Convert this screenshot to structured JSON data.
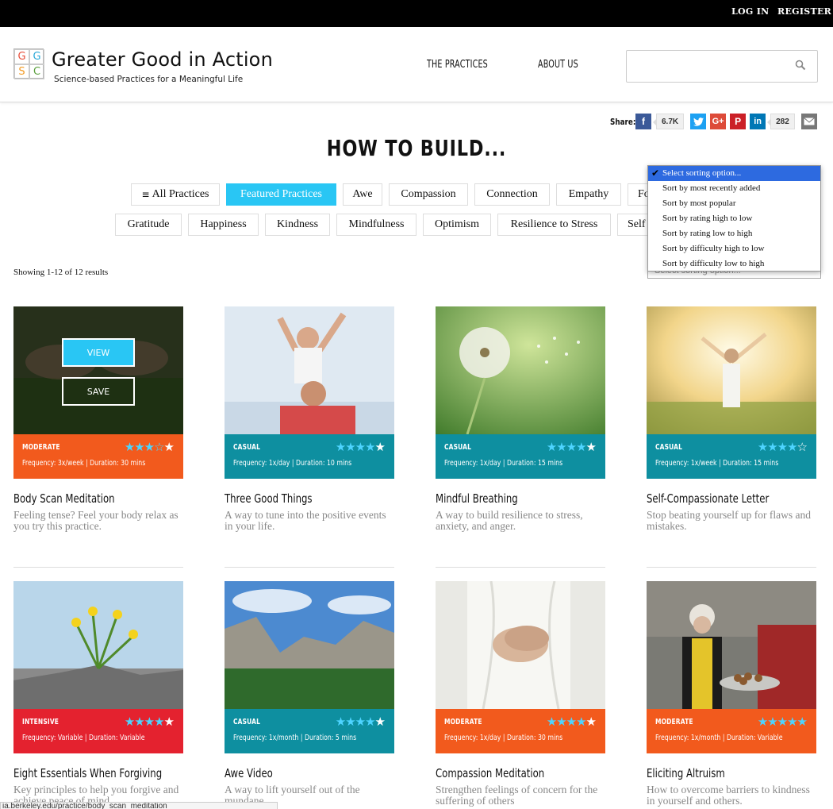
{
  "topbar": {
    "login": "LOG IN",
    "register": "REGISTER"
  },
  "logo": {
    "letters": [
      "G",
      "G",
      "S",
      "C"
    ],
    "title": "Greater Good in Action",
    "subtitle": "Science-based Practices for a Meaningful Life"
  },
  "nav": {
    "practices": "THE PRACTICES",
    "about": "ABOUT US"
  },
  "search": {
    "placeholder": "",
    "value": ""
  },
  "share": {
    "label": "Share:",
    "facebook_count": "6.7K",
    "linkedin_count": "282"
  },
  "page_title": "HOW TO BUILD...",
  "filters_row1": [
    "All Practices",
    "Featured Practices",
    "Awe",
    "Compassion",
    "Connection",
    "Empathy",
    "Fo"
  ],
  "filters_row2": [
    "Gratitude",
    "Happiness",
    "Kindness",
    "Mindfulness",
    "Optimism",
    "Resilience to Stress",
    "Self"
  ],
  "showing": "Showing 1-12 of 12 results",
  "sort": {
    "current": "Select sorting option...",
    "options": [
      "Select sorting option...",
      "Sort by most recently added",
      "Sort by most popular",
      "Sort by rating high to low",
      "Sort by rating low to high",
      "Sort by difficulty high to low",
      "Sort by difficulty low to high"
    ]
  },
  "overlay": {
    "view": "VIEW",
    "save": "SAVE"
  },
  "cards": [
    {
      "level": "MODERATE",
      "rating": 3.5,
      "meta": "Frequency: 3x/week  |  Duration: 30 mins",
      "title": "Body Scan Meditation",
      "desc": "Feeling tense? Feel your body relax as you try this practice.",
      "band": "orange"
    },
    {
      "level": "CASUAL",
      "rating": 4,
      "meta": "Frequency: 1x/day  |  Duration: 10 mins",
      "title": "Three Good Things",
      "desc": "A way to tune into the positive events in your life.",
      "band": "teal"
    },
    {
      "level": "CASUAL",
      "rating": 4,
      "meta": "Frequency: 1x/day  |  Duration: 15 mins",
      "title": "Mindful Breathing",
      "desc": "A way to build resilience to stress, anxiety, and anger.",
      "band": "teal"
    },
    {
      "level": "CASUAL",
      "rating": 4.5,
      "meta": "Frequency: 1x/week  |  Duration: 15 mins",
      "title": "Self-Compassionate Letter",
      "desc": "Stop beating yourself up for flaws and mistakes.",
      "band": "teal"
    },
    {
      "level": "INTENSIVE",
      "rating": 4,
      "meta": "Frequency: Variable  |  Duration: Variable",
      "title": "Eight Essentials When Forgiving",
      "desc": "Key principles to help you forgive and achieve peace of mind.",
      "band": "red"
    },
    {
      "level": "CASUAL",
      "rating": 4,
      "meta": "Frequency: 1x/month  |  Duration: 5 mins",
      "title": "Awe Video",
      "desc": "A way to lift yourself out of the mundane.",
      "band": "teal"
    },
    {
      "level": "MODERATE",
      "rating": 4,
      "meta": "Frequency: 1x/day  |  Duration: 30 mins",
      "title": "Compassion Meditation",
      "desc": "Strengthen feelings of concern for the suffering of others",
      "band": "orange"
    },
    {
      "level": "MODERATE",
      "rating": 5,
      "meta": "Frequency: 1x/month  |  Duration: Variable",
      "title": "Eliciting Altruism",
      "desc": "How to overcome barriers to kindness in yourself and others.",
      "band": "orange"
    }
  ],
  "status_url": "ia.berkeley.edu/practice/body_scan_meditation"
}
